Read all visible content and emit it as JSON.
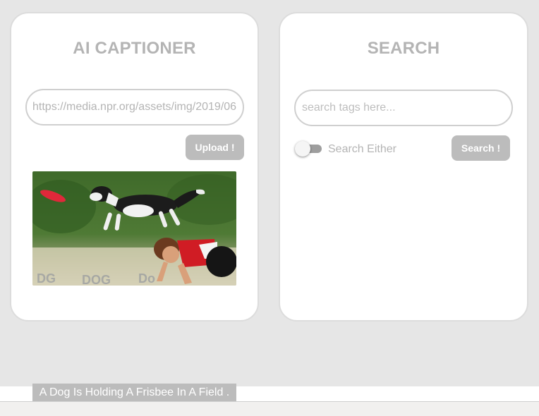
{
  "captioner": {
    "title": "AI CAPTIONER",
    "url_value": "https://media.npr.org/assets/img/2019/06",
    "upload_label": "Upload !",
    "caption": "A Dog Is Holding A Frisbee In A Field ."
  },
  "search": {
    "title": "SEARCH",
    "placeholder": "search tags here...",
    "toggle_label": "Search Either",
    "toggle_on": false,
    "button_label": "Search !"
  },
  "colors": {
    "background": "#e6e6e6",
    "card": "#ffffff",
    "muted_text": "#b4b4b4",
    "button": "#bcbcbc"
  }
}
